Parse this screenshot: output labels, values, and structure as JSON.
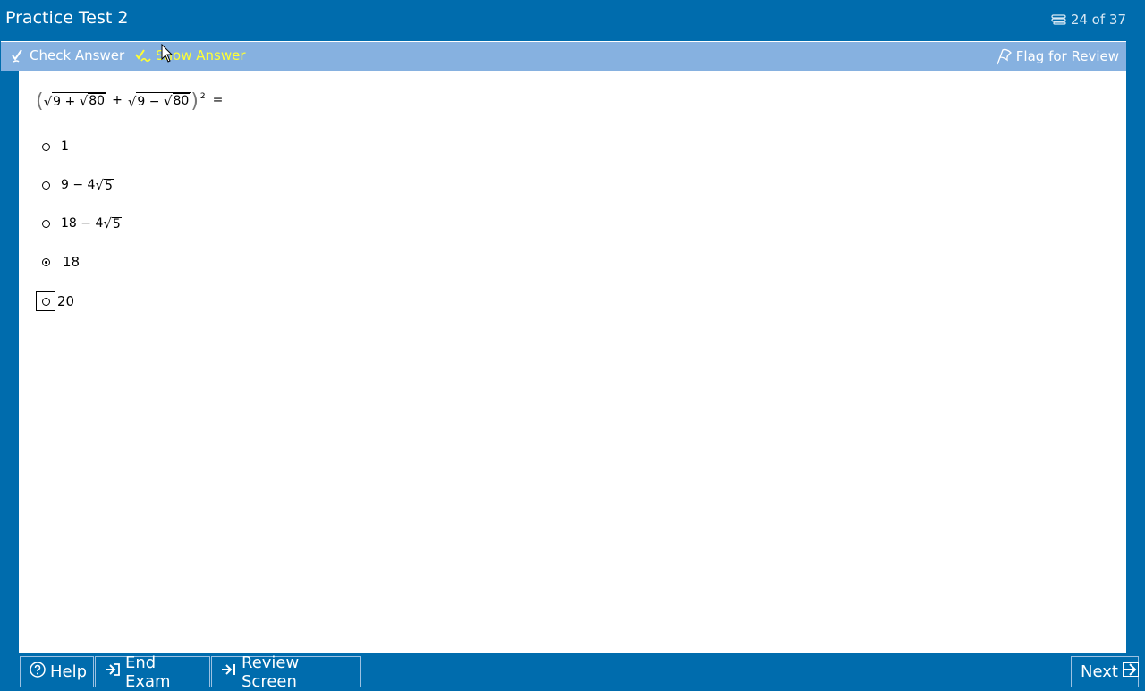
{
  "header": {
    "title": "Practice Test 2",
    "progress": "24 of 37"
  },
  "toolbar": {
    "check_answer": "Check Answer",
    "show_answer": "Show Answer",
    "flag_for_review": "Flag for Review"
  },
  "question": {
    "stem_parts": {
      "r1_a": "9 + ",
      "r1_b": "80",
      "plus": "+",
      "r2_a": "9 − ",
      "r2_b": "80",
      "exponent": "2",
      "equals": "="
    },
    "options": [
      {
        "text": "1",
        "selected": false
      },
      {
        "prefix": "9 − 4",
        "radicand": "5",
        "selected": false
      },
      {
        "prefix": "18 − 4",
        "radicand": "5",
        "selected": false
      },
      {
        "text": "18",
        "selected": true
      },
      {
        "text": "20",
        "selected": false,
        "focused": true
      }
    ]
  },
  "footer": {
    "help": "Help",
    "end_exam": "End Exam",
    "review_screen": "Review Screen",
    "next": "Next"
  },
  "colors": {
    "frame": "#006cad",
    "toolbar": "#86b1e0",
    "show_answer_text": "#ffff33"
  }
}
